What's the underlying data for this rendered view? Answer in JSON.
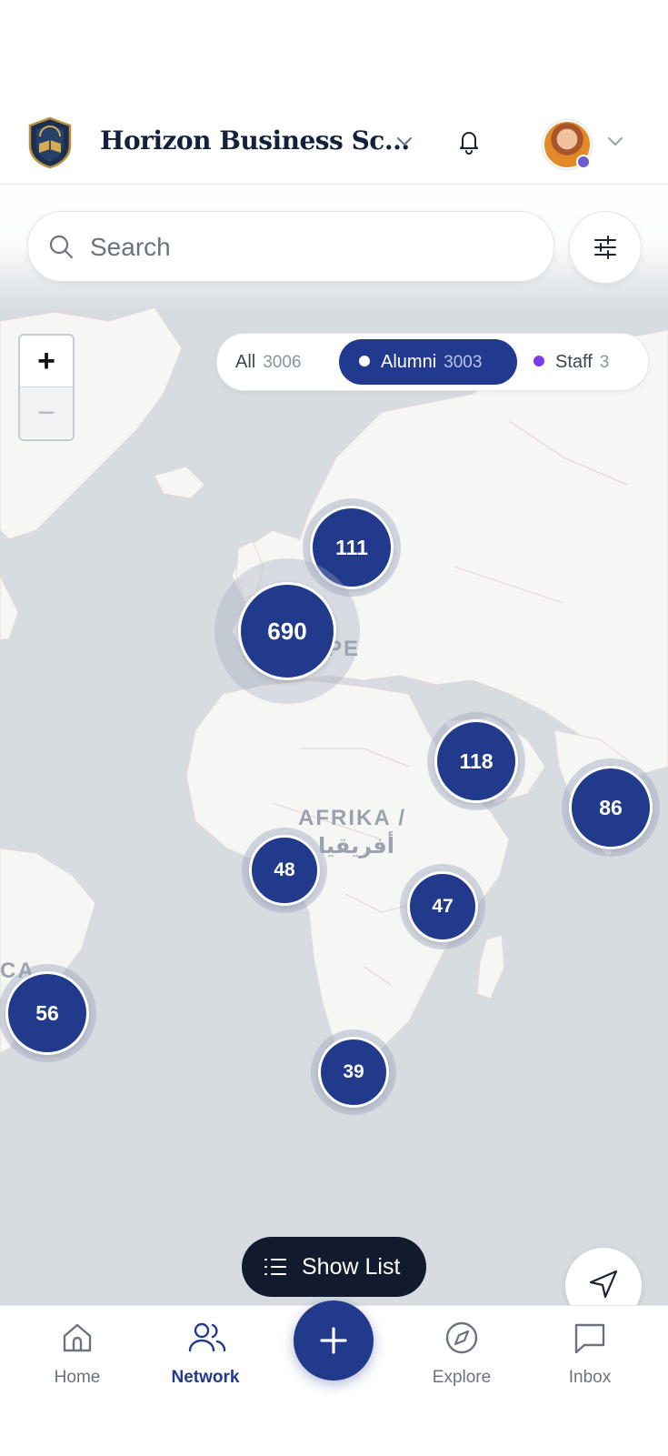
{
  "header": {
    "org_name": "Horizon Business Sc...",
    "logo_icon": "school-crest-icon",
    "notifications_icon": "bell-icon",
    "avatar_status_color": "#6d5bd0"
  },
  "search": {
    "placeholder": "Search",
    "filter_icon": "sliders-icon"
  },
  "zoom": {
    "in_label": "+",
    "out_label": "−"
  },
  "filters": [
    {
      "label": "All",
      "count": "3006",
      "selected": false
    },
    {
      "label": "Alumni",
      "count": "3003",
      "selected": true
    },
    {
      "label": "Staff",
      "count": "3",
      "selected": false
    }
  ],
  "map": {
    "labels": {
      "europe": "PE",
      "africa": "AFRIKA /",
      "africa_arabic": "أفريقيا",
      "south_america": "CA"
    },
    "clusters": [
      {
        "id": "scandinavia",
        "count": "111"
      },
      {
        "id": "western-europe",
        "count": "690"
      },
      {
        "id": "middle-east",
        "count": "118"
      },
      {
        "id": "south-asia",
        "count": "86"
      },
      {
        "id": "west-africa",
        "count": "48"
      },
      {
        "id": "east-africa",
        "count": "47"
      },
      {
        "id": "south-america",
        "count": "56"
      },
      {
        "id": "south-africa",
        "count": "39"
      }
    ]
  },
  "show_list": {
    "label": "Show List"
  },
  "bottom_nav": [
    {
      "label": "Home",
      "icon": "home-icon",
      "active": false
    },
    {
      "label": "Network",
      "icon": "users-icon",
      "active": true
    },
    {
      "label": "Explore",
      "icon": "compass-icon",
      "active": false
    },
    {
      "label": "Inbox",
      "icon": "chat-icon",
      "active": false
    }
  ],
  "colors": {
    "primary": "#213a8f",
    "staff": "#7c3aed",
    "map_water": "#d7dce1",
    "map_land": "#f6f6f5"
  }
}
